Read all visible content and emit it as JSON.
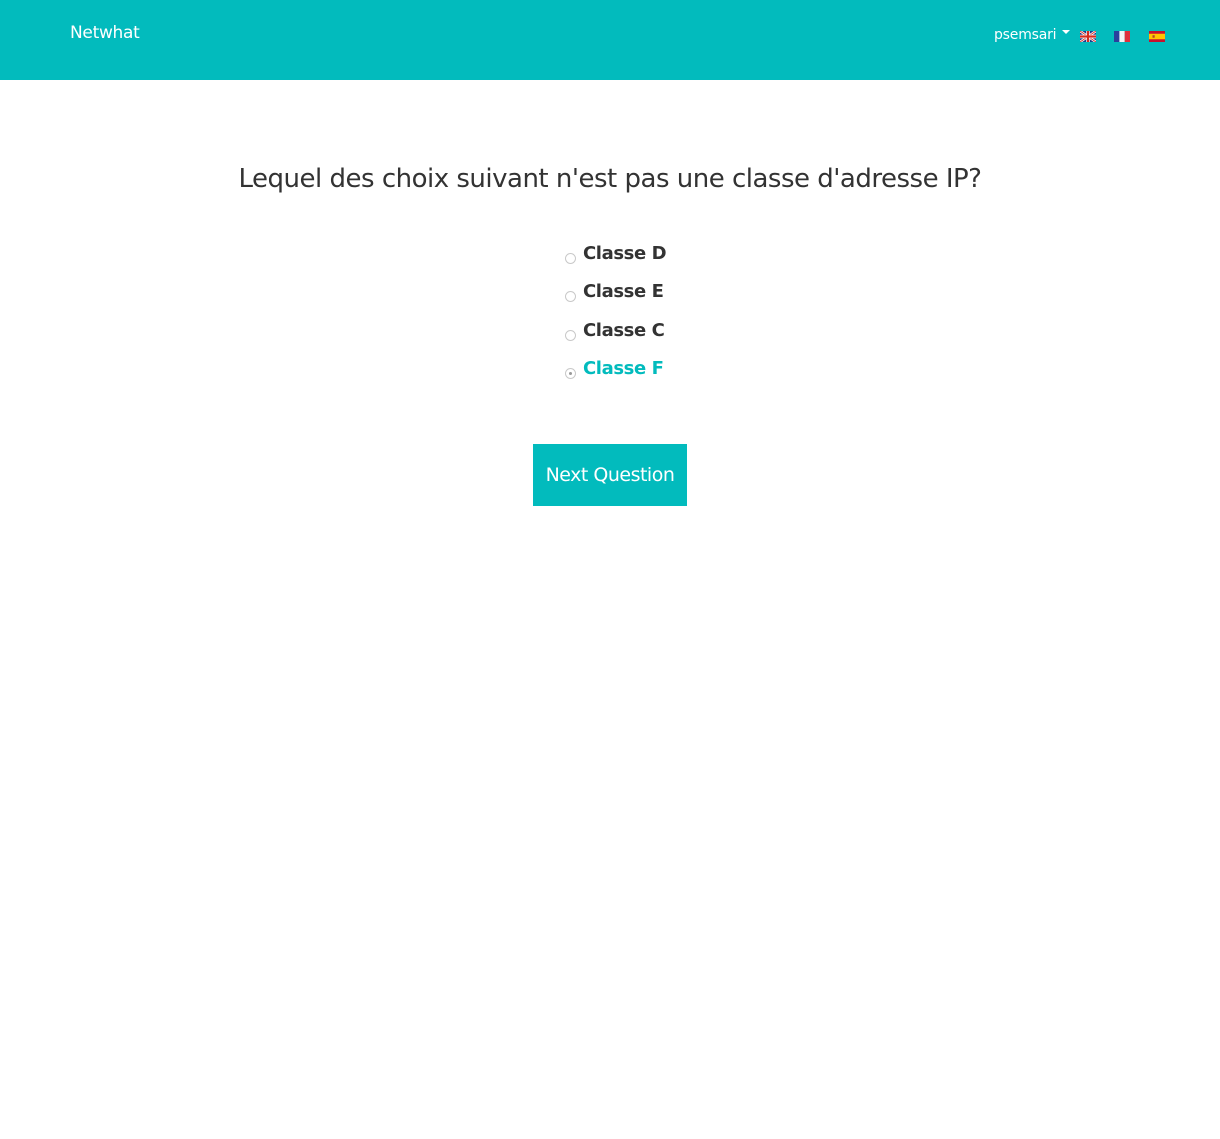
{
  "navbar": {
    "brand": "Netwhat",
    "user": "psemsari",
    "languages": [
      {
        "code": "en",
        "icon": "uk-flag-icon"
      },
      {
        "code": "fr",
        "icon": "france-flag-icon"
      },
      {
        "code": "es",
        "icon": "spain-flag-icon"
      }
    ],
    "background_color": "#02bbbd"
  },
  "quiz": {
    "question": "Lequel des choix suivant n'est pas une classe d'adresse IP?",
    "options": [
      {
        "label": "Classe D",
        "selected": false
      },
      {
        "label": "Classe E",
        "selected": false
      },
      {
        "label": "Classe C",
        "selected": false
      },
      {
        "label": "Classe F",
        "selected": true
      }
    ],
    "next_label": "Next Question",
    "accent_color": "#02bbbd"
  }
}
